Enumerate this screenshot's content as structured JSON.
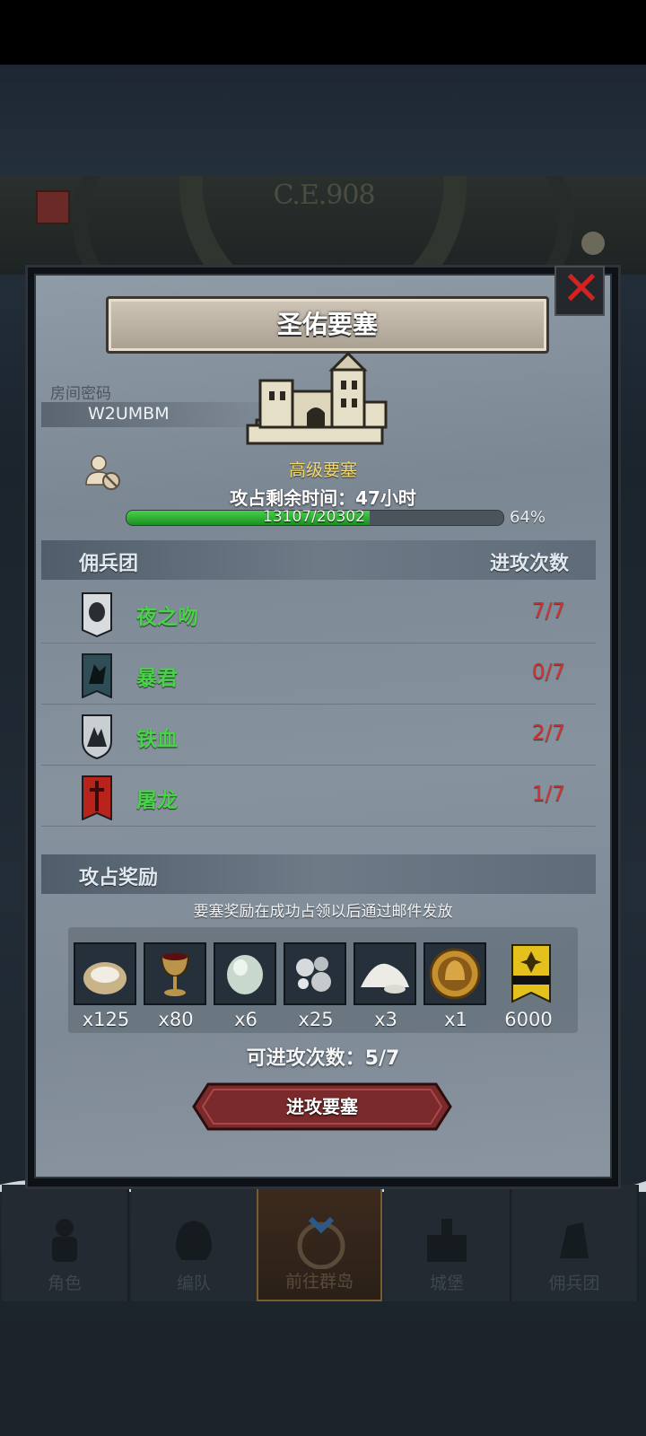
{
  "banner": {
    "era_text": "C.E.908"
  },
  "modal": {
    "title": "圣佑要塞",
    "close_label": "✕",
    "room": {
      "label": "房间密码",
      "code": "W2UMBM"
    },
    "fortress_level": "高级要塞",
    "time_left": "攻占剩余时间：47小时",
    "progress": {
      "text": "13107/20302",
      "current": 13107,
      "total": 20302,
      "percent_text": "64%",
      "fraction": 0.645
    },
    "mercenary_header": {
      "left": "佣兵团",
      "right": "进攻次数"
    },
    "mercenaries": [
      {
        "name": "夜之吻",
        "count": "7/7",
        "icon": "owl-shield-icon"
      },
      {
        "name": "暴君",
        "count": "0/7",
        "icon": "wolf-banner-icon"
      },
      {
        "name": "铁血",
        "count": "2/7",
        "icon": "mountain-shield-icon"
      },
      {
        "name": "屠龙",
        "count": "1/7",
        "icon": "sword-banner-icon"
      }
    ],
    "reward_header": "攻占奖励",
    "reward_note": "要塞奖励在成功占领以后通过邮件发放",
    "rewards": [
      {
        "qty": "x125",
        "icon": "grain-sack-icon"
      },
      {
        "qty": "x80",
        "icon": "goblet-icon"
      },
      {
        "qty": "x6",
        "icon": "gem-stone-icon"
      },
      {
        "qty": "x25",
        "icon": "silver-ore-icon"
      },
      {
        "qty": "x3",
        "icon": "salt-pile-icon"
      },
      {
        "qty": "x1",
        "icon": "knight-coin-icon"
      },
      {
        "qty": "6000",
        "icon": "gold-banner-icon"
      }
    ],
    "attacks_left": "可进攻次数：5/7",
    "attack_button": "进攻要塞"
  },
  "nav": [
    {
      "label": "角色",
      "icon": "knight-icon",
      "active": false
    },
    {
      "label": "编队",
      "icon": "helmet-icon",
      "active": false
    },
    {
      "label": "前往群岛",
      "icon": "compass-map-icon",
      "active": true
    },
    {
      "label": "城堡",
      "icon": "castle-icon",
      "active": false
    },
    {
      "label": "佣兵团",
      "icon": "mercenary-icon",
      "active": false
    }
  ],
  "colors": {
    "accent_green": "#4bd14b",
    "count_red": "#d33232",
    "gold_text": "#f3d86a",
    "button_red": "#7a2a2a"
  }
}
